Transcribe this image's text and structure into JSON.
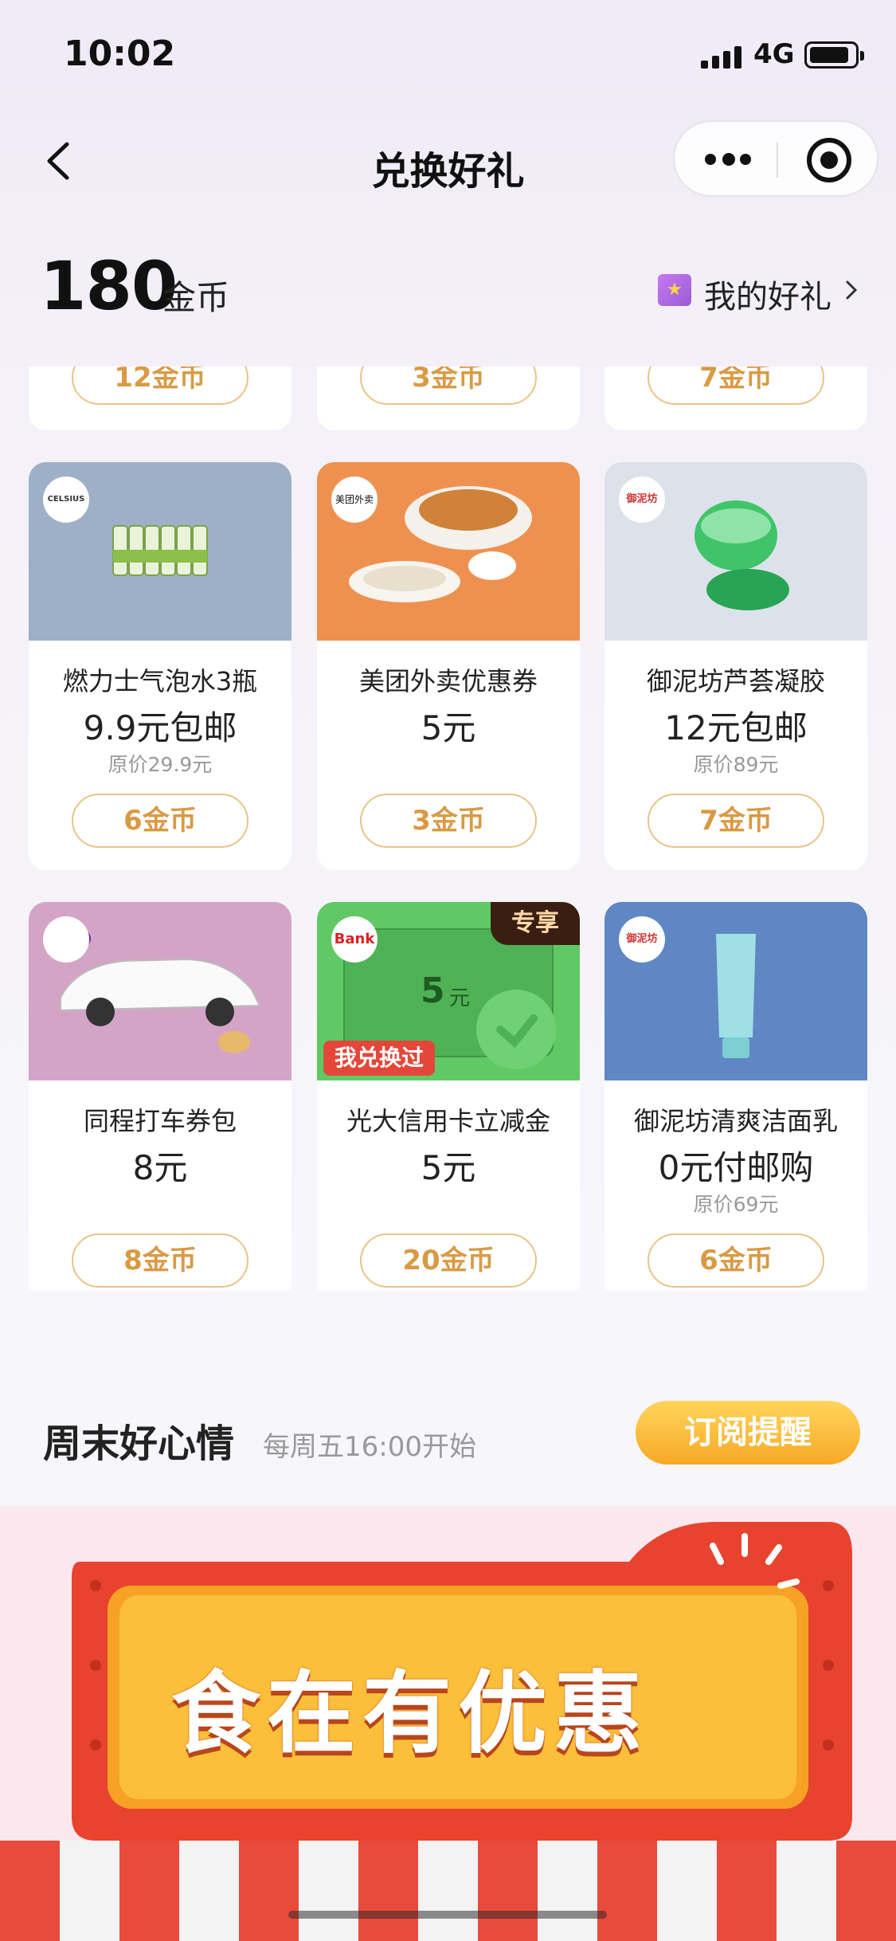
{
  "status_bar": {
    "time": "10:02",
    "network": "4G"
  },
  "nav": {
    "title": "兑换好礼"
  },
  "coins": {
    "amount": "180",
    "unit": "金币",
    "my_gifts": "我的好礼"
  },
  "top_partial_row": [
    {
      "button": "12金币"
    },
    {
      "button": "3金币"
    },
    {
      "button": "7金币"
    }
  ],
  "products_row1": [
    {
      "brand": "CELSIUS",
      "name": "燃力士气泡水3瓶",
      "price": "9.9元包邮",
      "original": "原价29.9元",
      "button": "6金币"
    },
    {
      "brand": "美团外卖",
      "name": "美团外卖优惠券",
      "price": "5元",
      "original": "",
      "button": "3金币"
    },
    {
      "brand": "御泥坊",
      "name": "御泥坊芦荟凝胶",
      "price": "12元包邮",
      "original": "原价89元",
      "button": "7金币"
    }
  ],
  "products_row2": [
    {
      "brand": "",
      "name": "同程打车券包",
      "price": "8元",
      "original": "",
      "button": "8金币"
    },
    {
      "brand": "Bank",
      "name": "光大信用卡立减金",
      "price": "5元",
      "original": "",
      "button": "20金币",
      "tag": "专享",
      "redeemed": "我兑换过",
      "coupon_value": "5",
      "coupon_unit": "元"
    },
    {
      "brand": "御泥坊",
      "name": "御泥坊清爽洁面乳",
      "price": "0元付邮购",
      "original": "原价69元",
      "button": "6金币"
    }
  ],
  "weekend": {
    "title": "周末好心情",
    "subtitle": "每周五16:00开始",
    "subscribe": "订阅提醒"
  },
  "banner": {
    "text": "食在有优惠"
  },
  "colors": {
    "accent_gold": "#d99a45",
    "button_border": "#e9c38a",
    "subscribe_gradient_top": "#ffd45c",
    "subscribe_gradient_bottom": "#f7a925",
    "banner_red": "#e8432e"
  }
}
